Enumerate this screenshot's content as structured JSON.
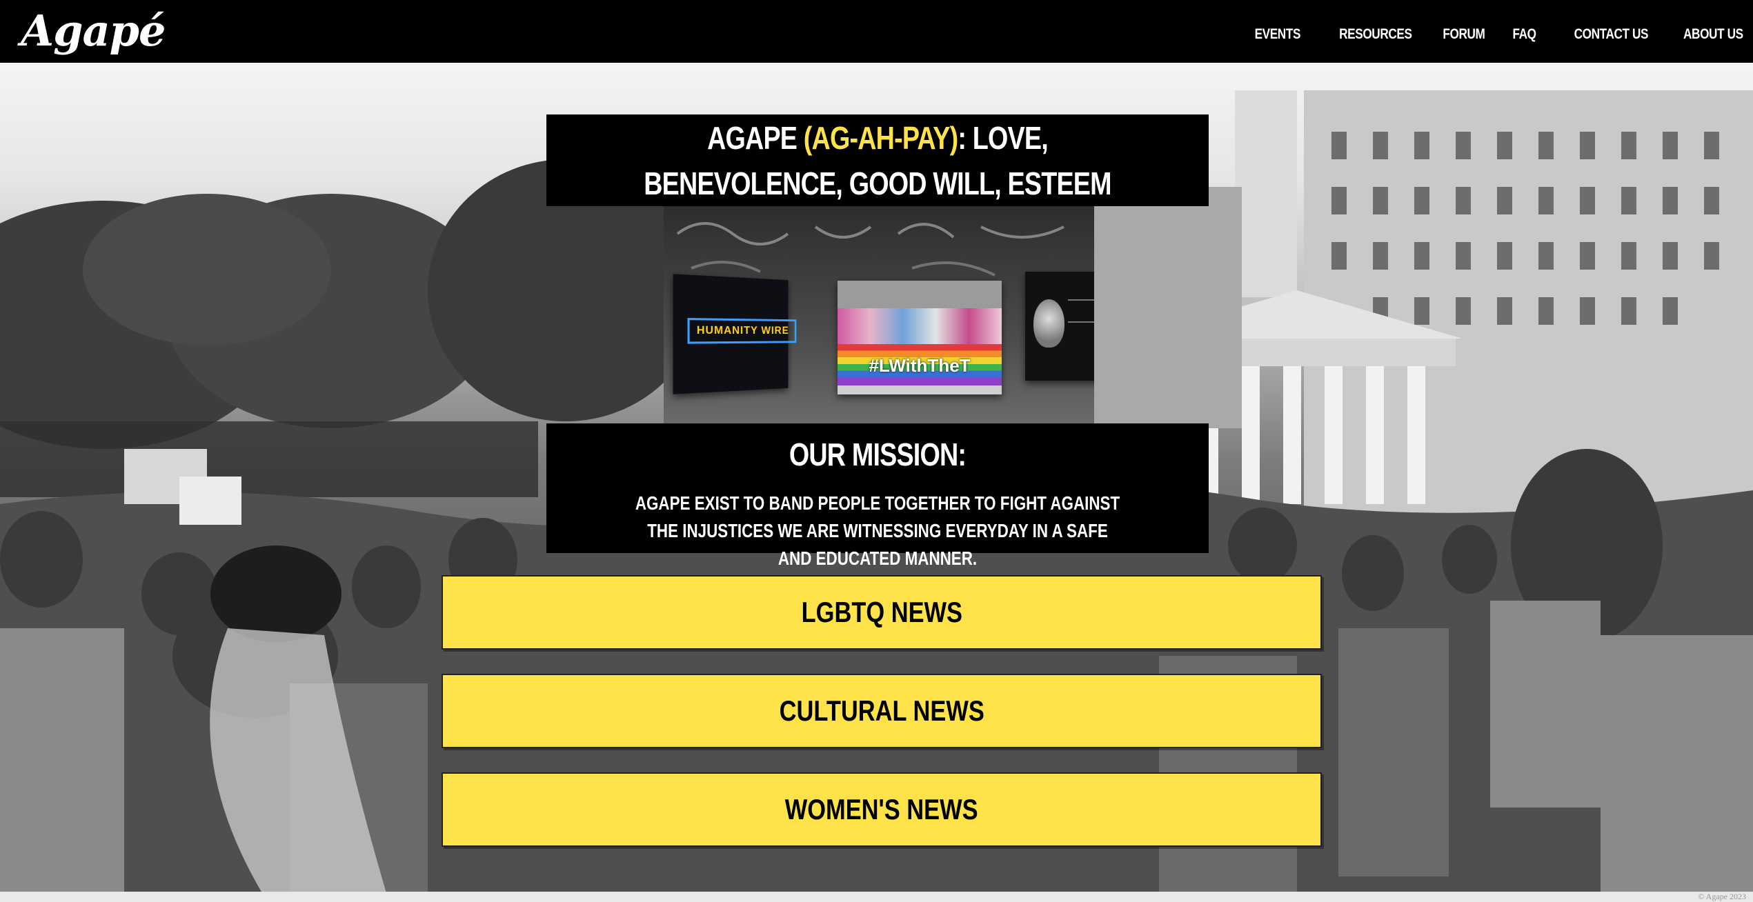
{
  "site": {
    "logo": "Agapé"
  },
  "nav": {
    "items": [
      {
        "label": "EVENTS"
      },
      {
        "label": "RESOURCES"
      },
      {
        "label": "FORUM"
      },
      {
        "label": "FAQ"
      },
      {
        "label": "CONTACT US"
      },
      {
        "label": "ABOUT US"
      }
    ]
  },
  "hero": {
    "title_word": "AGAPE",
    "title_pronunciation": "(AG-AH-PAY)",
    "title_definition": ": LOVE, BENEVOLENCE, GOOD WILL, ESTEEM",
    "accent_color": "#ffe14a"
  },
  "collage": {
    "left_card_text": "HUMANITY WIRE",
    "middle_card_text": "#LWithTheT"
  },
  "mission": {
    "heading": "OUR MISSION:",
    "text": "AGAPE EXIST TO BAND PEOPLE TOGETHER TO FIGHT AGAINST THE INJUSTICES WE ARE WITNESSING EVERYDAY IN A SAFE AND EDUCATED MANNER."
  },
  "news_buttons": [
    {
      "label": "LGBTQ NEWS"
    },
    {
      "label": "CULTURAL NEWS"
    },
    {
      "label": "WOMEN'S NEWS"
    }
  ],
  "button_color": "#fde24a",
  "footer": {
    "copyright": "© Agape 2023"
  }
}
